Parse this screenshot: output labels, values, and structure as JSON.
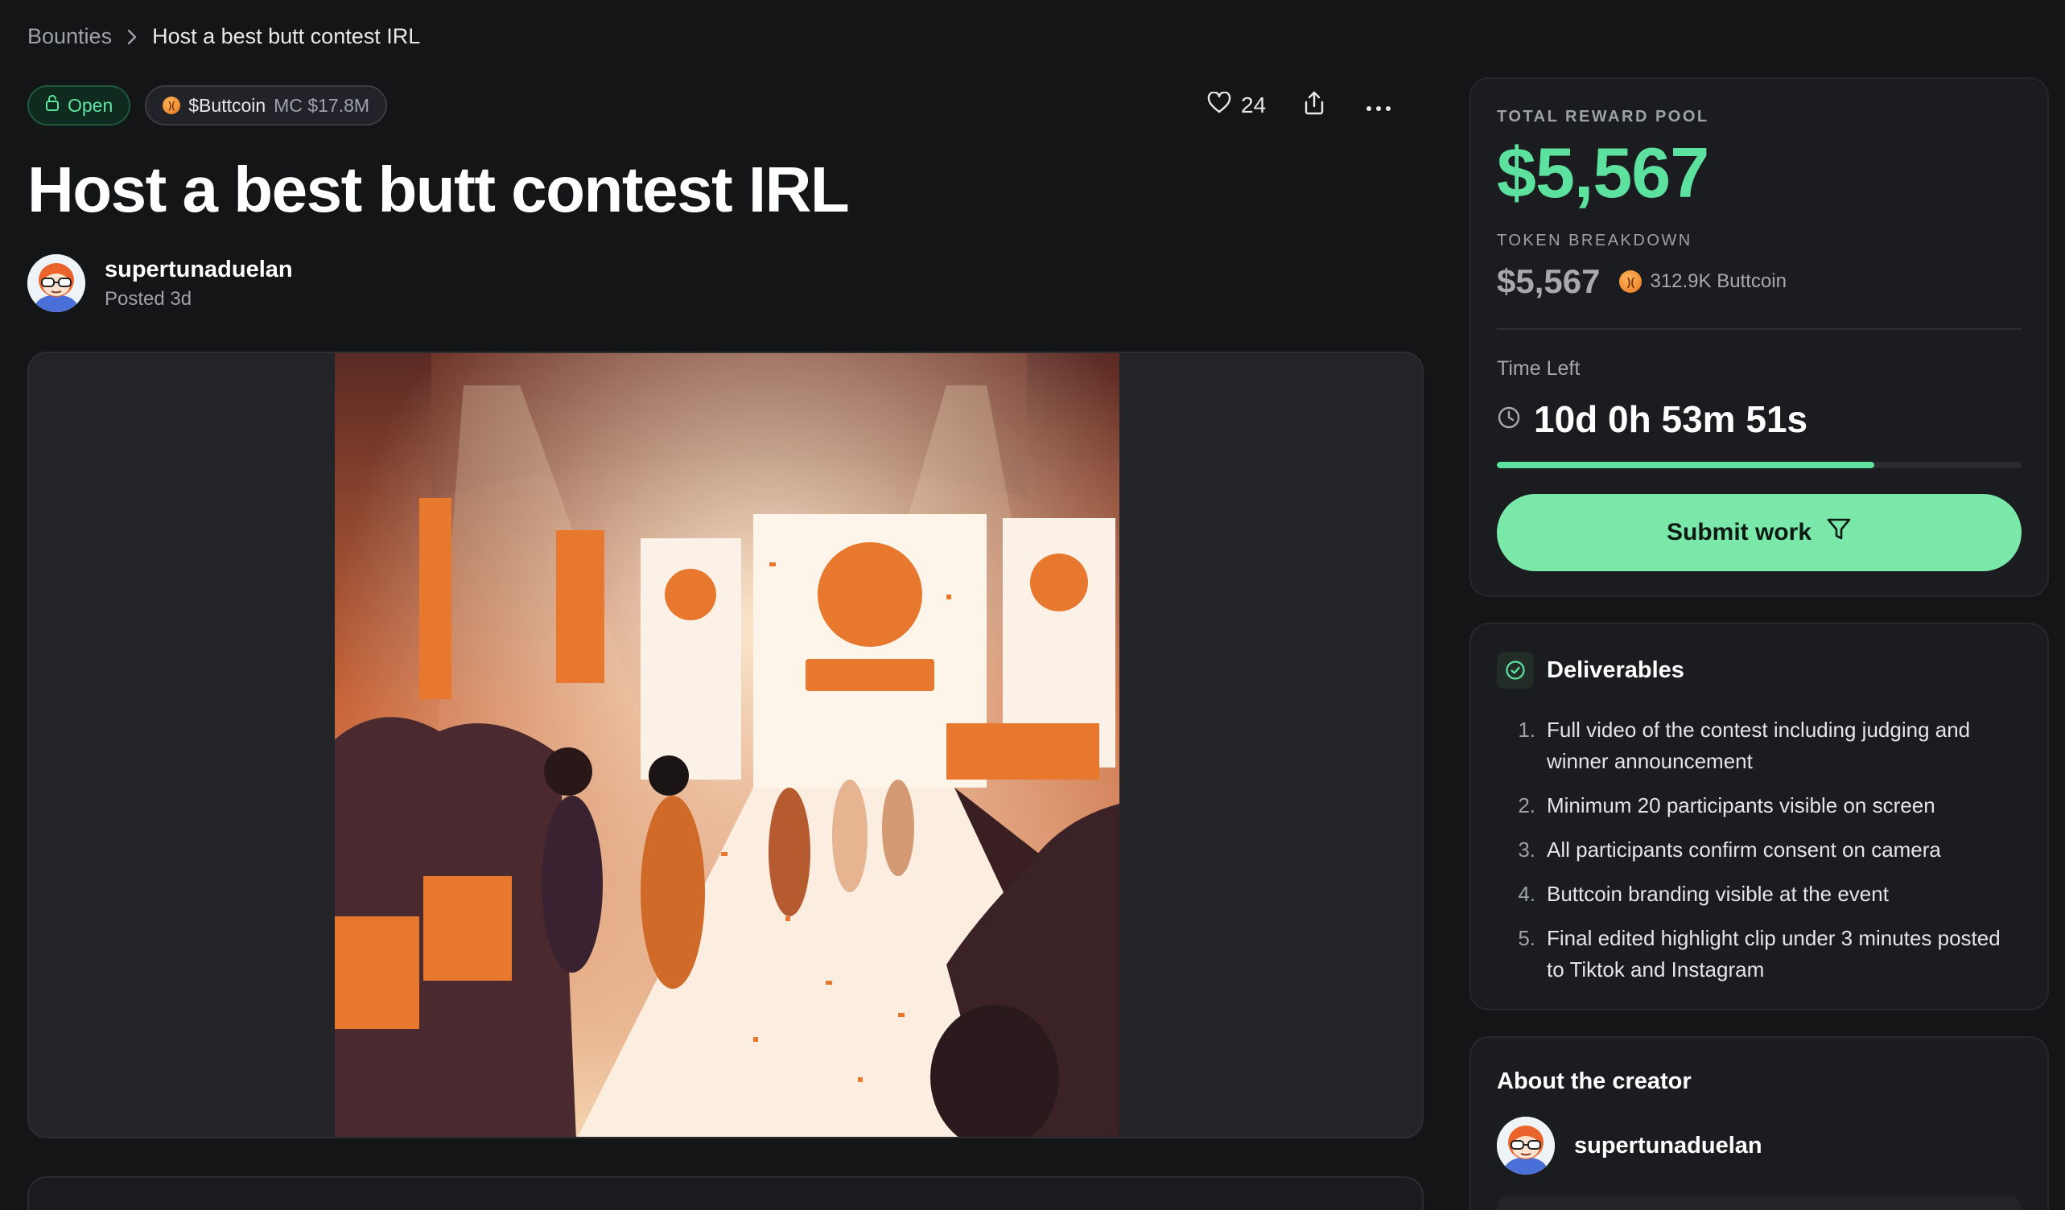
{
  "breadcrumb": {
    "root": "Bounties",
    "current": "Host a best butt contest IRL"
  },
  "badges": {
    "status": "Open",
    "token": "$Buttcoin",
    "market_cap": "MC $17.8M"
  },
  "actions": {
    "likes": "24",
    "icons": [
      "heart-icon",
      "share-icon",
      "more-icon"
    ]
  },
  "bounty": {
    "title": "Host a best butt contest IRL",
    "author": "supertunaduelan",
    "posted": "Posted 3d"
  },
  "reward": {
    "label": "TOTAL REWARD POOL",
    "amount": "$5,567",
    "breakdown_label": "TOKEN BREAKDOWN",
    "breakdown_usd": "$5,567",
    "breakdown_token": "312.9K Buttcoin",
    "time_label": "Time Left",
    "time_value": "10d 0h 53m 51s",
    "progress_fraction": 0.72,
    "submit_label": "Submit work"
  },
  "deliverables": {
    "title": "Deliverables",
    "items": [
      {
        "num": "1.",
        "text": "Full video of the contest including judging and winner announcement"
      },
      {
        "num": "2.",
        "text": "Minimum 20 participants visible on screen"
      },
      {
        "num": "3.",
        "text": "All participants confirm consent on camera"
      },
      {
        "num": "4.",
        "text": "Buttcoin branding visible at the event"
      },
      {
        "num": "5.",
        "text": "Final edited highlight clip under 3 minutes posted to Tiktok and Instagram"
      }
    ]
  },
  "about": {
    "title": "About the creator",
    "name": "supertunaduelan"
  },
  "colors": {
    "accent": "#5ce29e",
    "button": "#7ae8a8",
    "background": "#141517",
    "card": "#1b1c1f",
    "token": "#f08a2e"
  }
}
